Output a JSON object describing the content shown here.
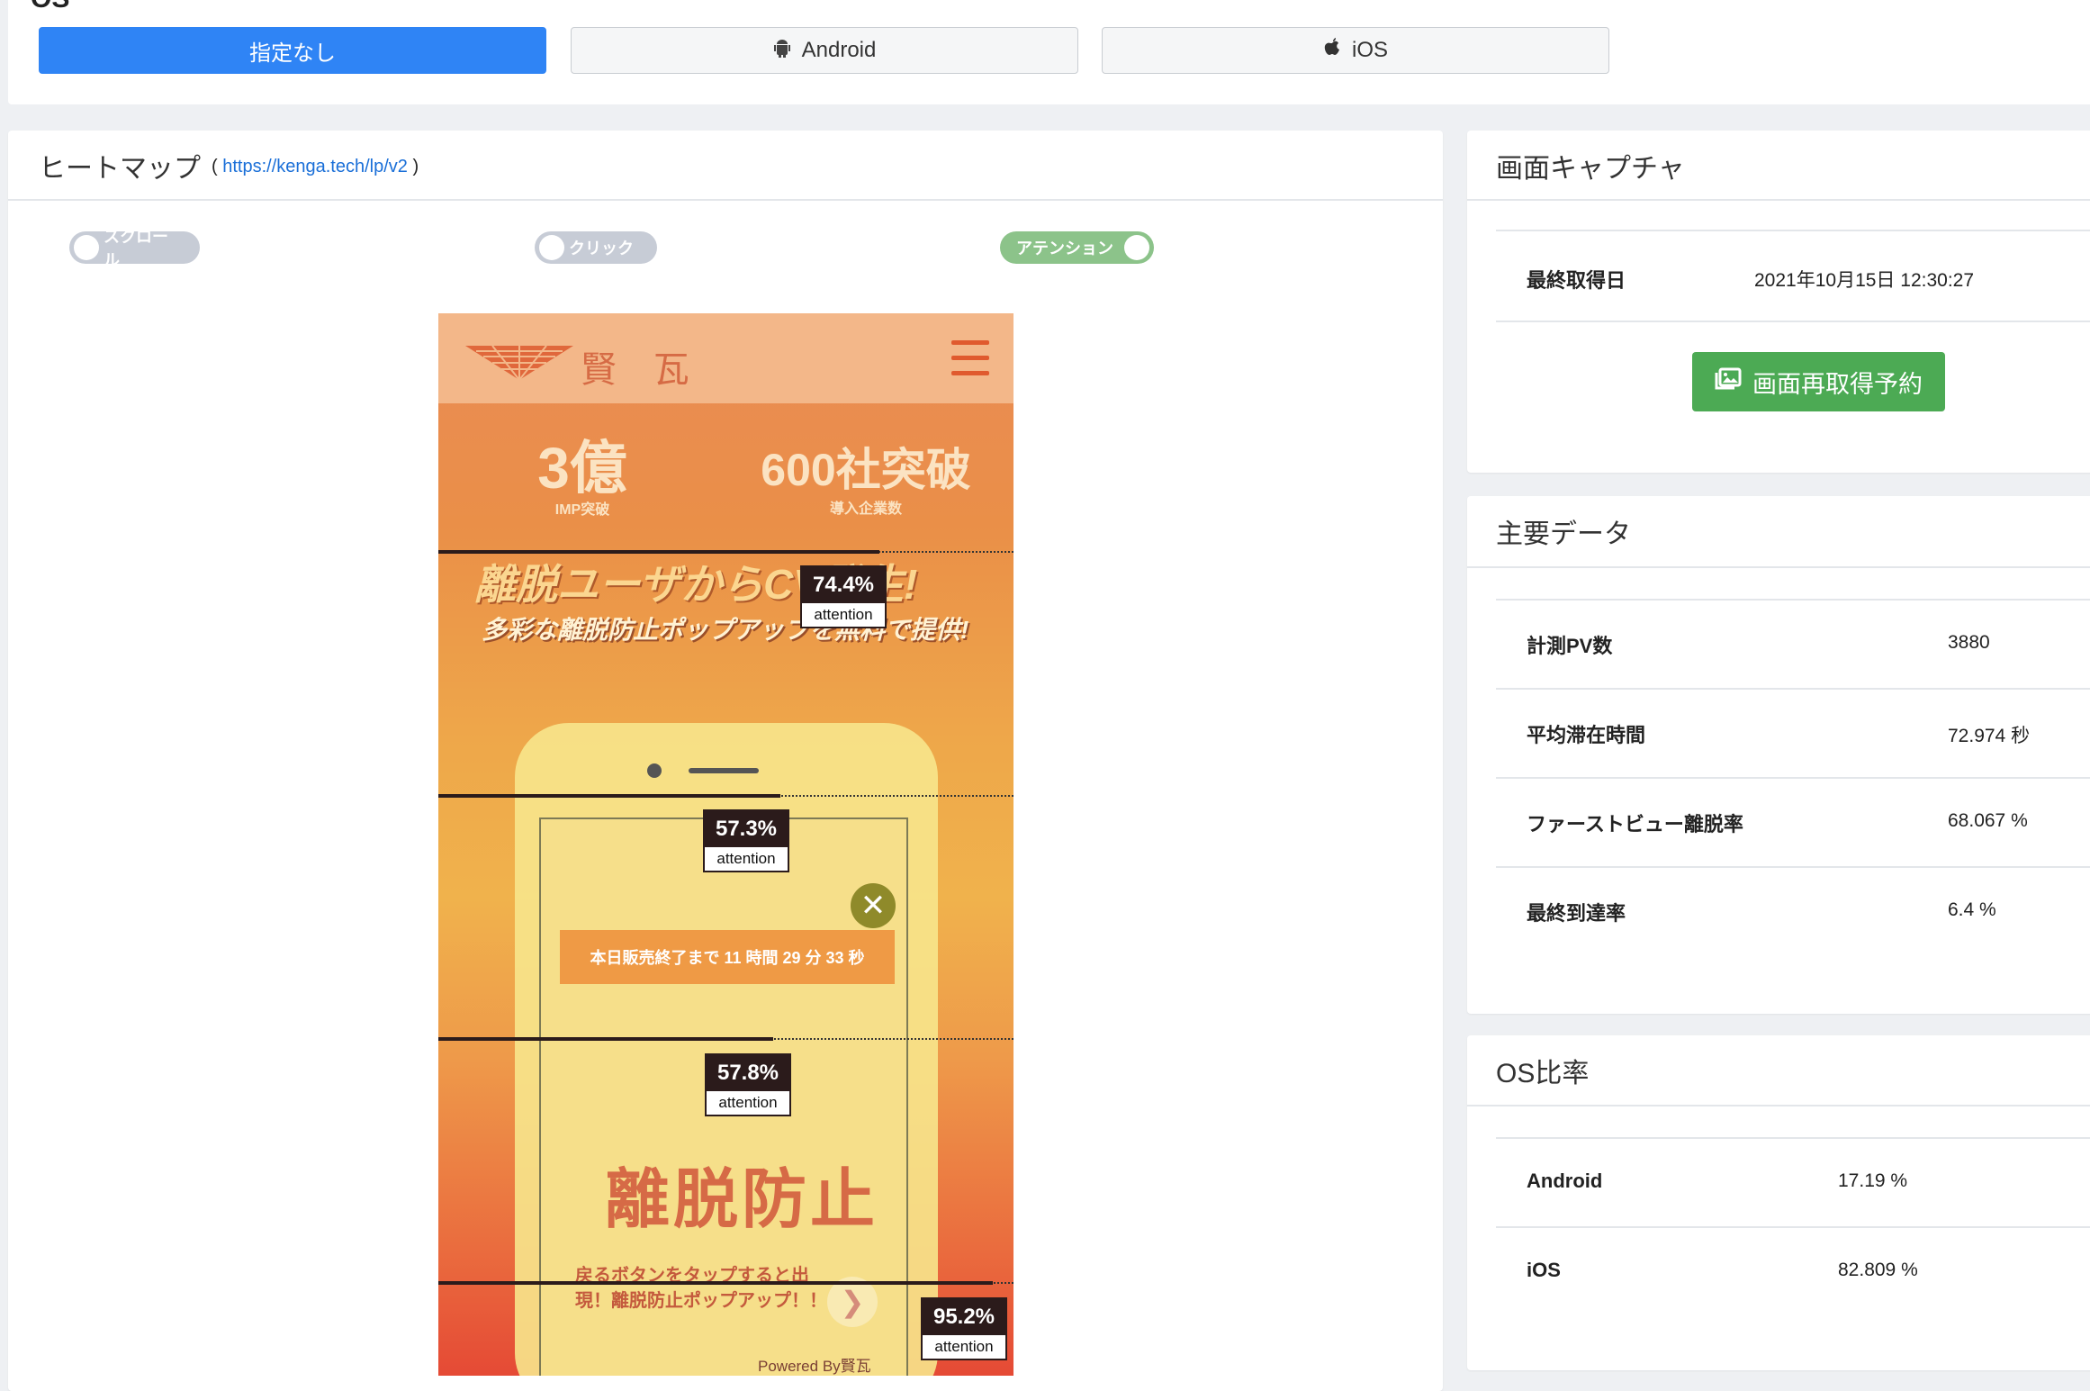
{
  "os_filter": {
    "heading": "OS",
    "buttons": [
      {
        "label": "指定なし",
        "active": true
      },
      {
        "label": "Android",
        "active": false
      },
      {
        "label": "iOS",
        "active": false
      }
    ]
  },
  "heatmap": {
    "title": "ヒートマップ",
    "url": "https://kenga.tech/lp/v2",
    "toggles": [
      {
        "label": "スクロール",
        "on": false
      },
      {
        "label": "クリック",
        "on": false
      },
      {
        "label": "アテンション",
        "on": true
      }
    ],
    "lp": {
      "logo_text": "賢 瓦",
      "award1_big": "3億",
      "award1_small": "IMP突破",
      "award2_big": "600社突破",
      "award2_small": "導入企業数",
      "headline": "離脱ユーザからCV発生!",
      "sub": "多彩な離脱防止ポップアップを無料で提供!",
      "timer": "本日販売終了まで 11 時間 29 分 33 秒",
      "popup_title": "離脱防止",
      "popup_body": "戻るボタンをタップすると出現！離脱防止ポップアップ！！",
      "powered": "Powered By賢瓦"
    },
    "attention_markers": [
      {
        "percent": "74.4%",
        "label": "attention"
      },
      {
        "percent": "57.3%",
        "label": "attention"
      },
      {
        "percent": "57.8%",
        "label": "attention"
      },
      {
        "percent": "95.2%",
        "label": "attention"
      }
    ]
  },
  "capture": {
    "title": "画面キャプチャ",
    "last_label": "最終取得日",
    "last_value": "2021年10月15日 12:30:27",
    "button": "画面再取得予約"
  },
  "main_data": {
    "title": "主要データ",
    "rows": [
      {
        "label": "計測PV数",
        "value": "3880"
      },
      {
        "label": "平均滞在時間",
        "value": "72.974 秒"
      },
      {
        "label": "ファーストビュー離脱率",
        "value": "68.067 %"
      },
      {
        "label": "最終到達率",
        "value": "6.4 %"
      }
    ]
  },
  "os_ratio": {
    "title": "OS比率",
    "rows": [
      {
        "label": "Android",
        "value": "17.19 %"
      },
      {
        "label": "iOS",
        "value": "82.809 %"
      }
    ]
  },
  "colors": {
    "primary": "#2f84f5",
    "success": "#4caa54",
    "toggle_on": "#8cc38a",
    "toggle_off": "#c7ccd6",
    "link": "#1a6fd8"
  }
}
